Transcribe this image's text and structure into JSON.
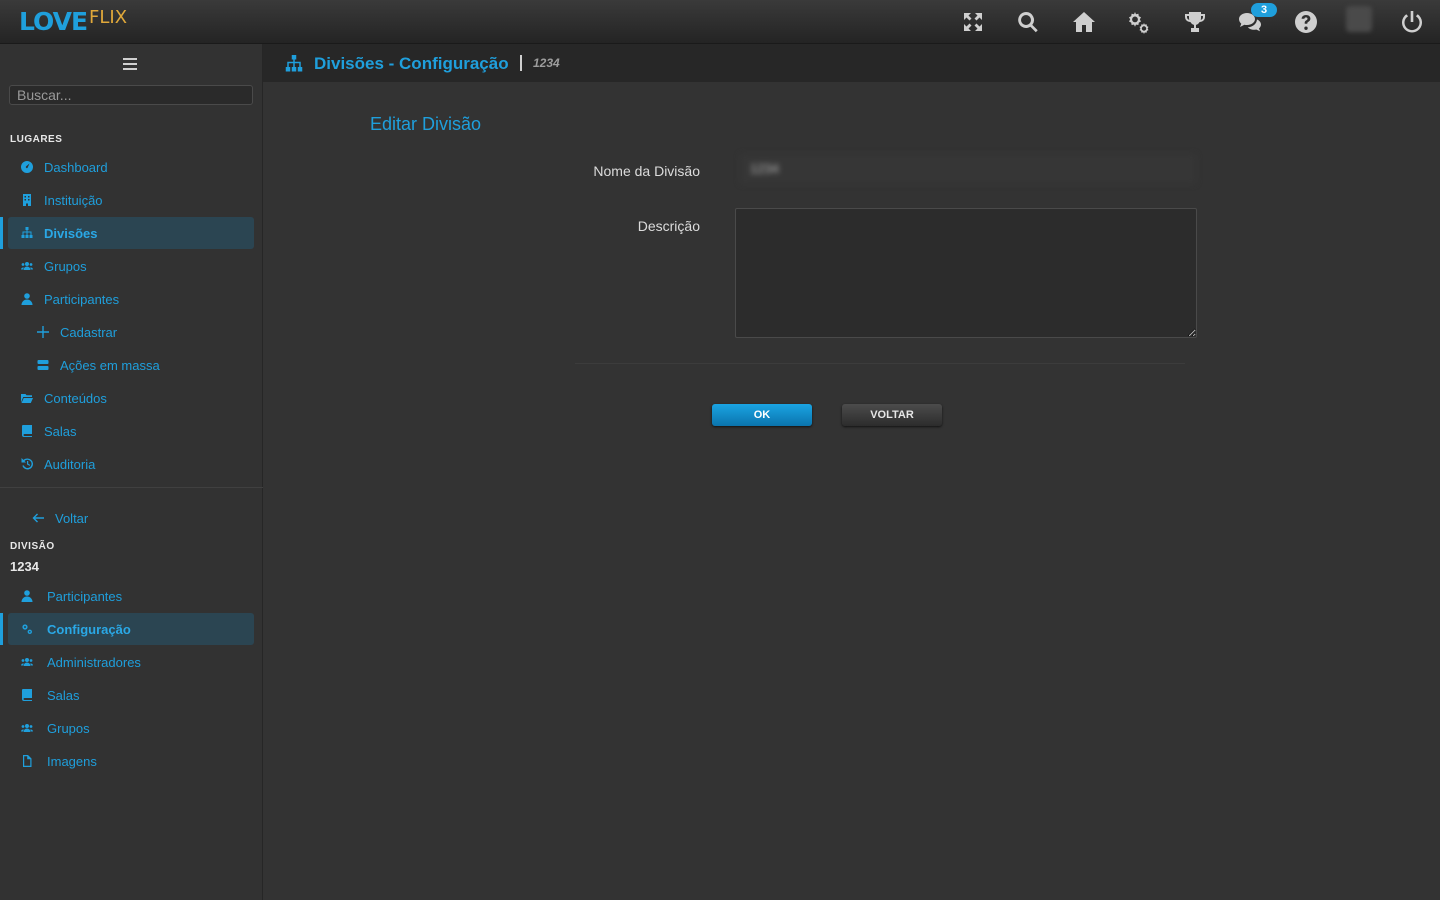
{
  "app": {
    "logo_love": "LOVE",
    "logo_flix": "FLIX"
  },
  "topbar": {
    "icons": [
      "fullscreen-icon",
      "search-icon",
      "home-icon",
      "gears-icon",
      "trophy-icon",
      "chat-icon",
      "help-icon",
      "avatar",
      "power-icon"
    ],
    "chat_badge": "3"
  },
  "sidebar": {
    "search_placeholder": "Buscar...",
    "places_title": "LUGARES",
    "places": [
      {
        "label": "Dashboard",
        "icon": "dashboard-icon"
      },
      {
        "label": "Instituição",
        "icon": "building-icon"
      },
      {
        "label": "Divisões",
        "icon": "sitemap-icon",
        "active": true
      },
      {
        "label": "Grupos",
        "icon": "users-icon"
      },
      {
        "label": "Participantes",
        "icon": "user-icon"
      },
      {
        "label": "Cadastrar",
        "icon": "plus-icon"
      },
      {
        "label": "Ações em massa",
        "icon": "layers-icon"
      },
      {
        "label": "Conteúdos",
        "icon": "folder-icon"
      },
      {
        "label": "Salas",
        "icon": "book-icon"
      },
      {
        "label": "Auditoria",
        "icon": "history-icon"
      }
    ],
    "back_label": "Voltar",
    "division_title": "DIVISÃO",
    "division_code": "1234",
    "division_items": [
      {
        "label": "Participantes",
        "icon": "user-icon"
      },
      {
        "label": "Configuração",
        "icon": "gears-icon",
        "active": true
      },
      {
        "label": "Administradores",
        "icon": "users-icon"
      },
      {
        "label": "Salas",
        "icon": "book-icon"
      },
      {
        "label": "Grupos",
        "icon": "users-icon"
      },
      {
        "label": "Imagens",
        "icon": "file-icon"
      }
    ]
  },
  "page": {
    "title": "Divisões - Configuração",
    "code": "1234"
  },
  "form": {
    "title": "Editar Divisão",
    "name_label": "Nome da Divisão",
    "name_value": "1234",
    "desc_label": "Descrição",
    "desc_value": "",
    "ok_label": "OK",
    "back_label": "VOLTAR"
  },
  "colors": {
    "accent": "#1f9fdc",
    "logo_secondary": "#e0a83a",
    "background": "#333333"
  }
}
